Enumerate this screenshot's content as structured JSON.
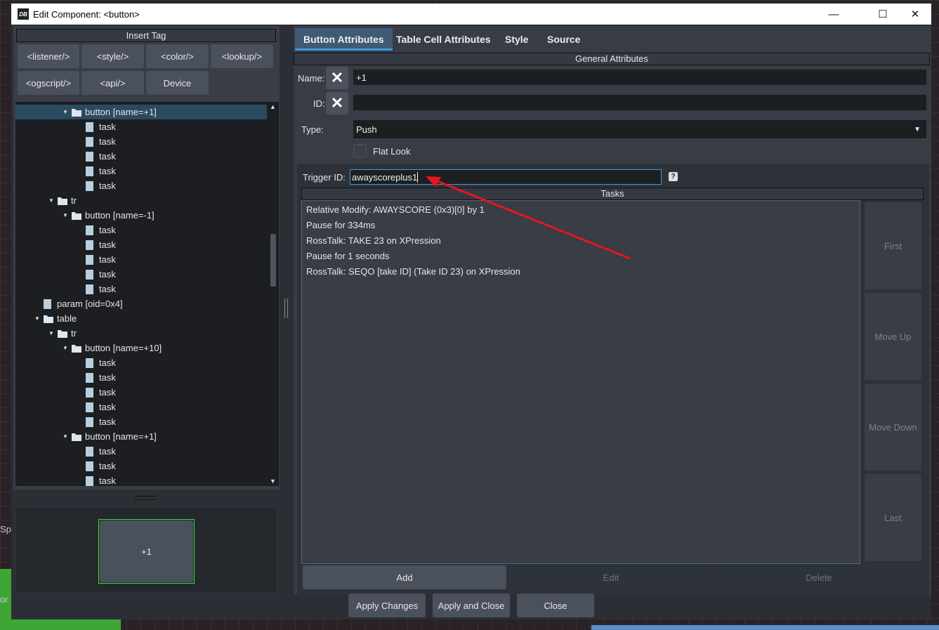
{
  "background": {
    "left_text_1": "Sp",
    "left_text_2": "or"
  },
  "window": {
    "title": "Edit Component: <button>",
    "logo": "DB",
    "minimize": "—",
    "maximize": "☐",
    "close": "✕"
  },
  "insert_tag": {
    "header": "Insert Tag",
    "buttons": [
      "<listener/>",
      "<style/>",
      "<color/>",
      "<lookup/>",
      "<ogscript/>",
      "<api/>",
      "Device"
    ]
  },
  "tree": [
    {
      "label": "button [name=+1]",
      "depth": 3,
      "type": "folder",
      "selected": true
    },
    {
      "label": "task",
      "depth": 4,
      "type": "file"
    },
    {
      "label": "task",
      "depth": 4,
      "type": "file"
    },
    {
      "label": "task",
      "depth": 4,
      "type": "file"
    },
    {
      "label": "task",
      "depth": 4,
      "type": "file"
    },
    {
      "label": "task",
      "depth": 4,
      "type": "file"
    },
    {
      "label": "tr",
      "depth": 2,
      "type": "folder"
    },
    {
      "label": "button [name=-1]",
      "depth": 3,
      "type": "folder"
    },
    {
      "label": "task",
      "depth": 4,
      "type": "file"
    },
    {
      "label": "task",
      "depth": 4,
      "type": "file"
    },
    {
      "label": "task",
      "depth": 4,
      "type": "file"
    },
    {
      "label": "task",
      "depth": 4,
      "type": "file"
    },
    {
      "label": "task",
      "depth": 4,
      "type": "file"
    },
    {
      "label": "param [oid=0x4]",
      "depth": 1,
      "type": "file"
    },
    {
      "label": "table",
      "depth": 1,
      "type": "folder"
    },
    {
      "label": "tr",
      "depth": 2,
      "type": "folder"
    },
    {
      "label": "button [name=+10]",
      "depth": 3,
      "type": "folder"
    },
    {
      "label": "task",
      "depth": 4,
      "type": "file"
    },
    {
      "label": "task",
      "depth": 4,
      "type": "file"
    },
    {
      "label": "task",
      "depth": 4,
      "type": "file"
    },
    {
      "label": "task",
      "depth": 4,
      "type": "file"
    },
    {
      "label": "task",
      "depth": 4,
      "type": "file"
    },
    {
      "label": "button [name=+1]",
      "depth": 3,
      "type": "folder"
    },
    {
      "label": "task",
      "depth": 4,
      "type": "file"
    },
    {
      "label": "task",
      "depth": 4,
      "type": "file"
    },
    {
      "label": "task",
      "depth": 4,
      "type": "file"
    }
  ],
  "preview": {
    "button_label": "+1"
  },
  "tabs": [
    "Button Attributes",
    "Table Cell Attributes",
    "Style",
    "Source"
  ],
  "general": {
    "header": "General Attributes",
    "name_label": "Name:",
    "name_value": "+1",
    "id_label": "ID:",
    "id_value": "",
    "type_label": "Type:",
    "type_value": "Push",
    "flat_look_label": "Flat Look",
    "flat_look_checked": false
  },
  "trigger": {
    "label": "Trigger ID:",
    "value": "awayscoreplus1",
    "help": "?"
  },
  "tasks": {
    "header": "Tasks",
    "items": [
      "Relative Modify: AWAYSCORE (0x3)[0] by 1",
      "Pause for 334ms",
      "RossTalk:  TAKE 23 on XPression",
      "Pause for 1 seconds",
      "RossTalk: SEQO [take ID] (Take ID 23) on XPression"
    ],
    "side_buttons": [
      "First",
      "Move Up",
      "Move Down",
      "Last"
    ],
    "add": "Add",
    "edit": "Edit",
    "delete": "Delete"
  },
  "footer": {
    "apply": "Apply Changes",
    "apply_close": "Apply and Close",
    "close": "Close"
  },
  "colors": {
    "accent": "#3b9de0",
    "annotation_arrow": "#e8141c",
    "preview_border": "#2ee82e"
  }
}
